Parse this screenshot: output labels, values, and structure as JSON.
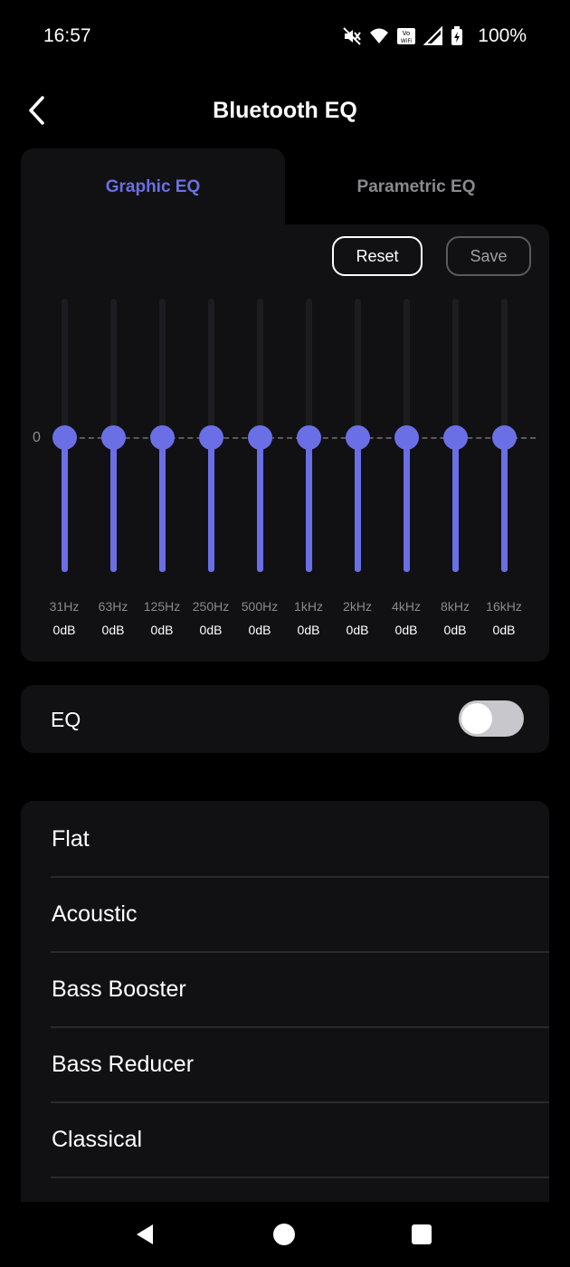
{
  "status_bar": {
    "time": "16:57",
    "battery": "100%",
    "icons": [
      "mute-icon",
      "wifi-icon",
      "vowifi-icon",
      "signal-icon",
      "battery-icon"
    ]
  },
  "header": {
    "title": "Bluetooth EQ",
    "back_icon": "chevron-left-icon"
  },
  "tabs": [
    {
      "label": "Graphic EQ",
      "active": true
    },
    {
      "label": "Parametric EQ",
      "active": false
    }
  ],
  "eq": {
    "reset_label": "Reset",
    "save_label": "Save",
    "zero_label": "0",
    "accent_color": "#6b6fe6",
    "bands": [
      {
        "freq": "31Hz",
        "gain": "0dB",
        "level": 0
      },
      {
        "freq": "63Hz",
        "gain": "0dB",
        "level": 0
      },
      {
        "freq": "125Hz",
        "gain": "0dB",
        "level": 0
      },
      {
        "freq": "250Hz",
        "gain": "0dB",
        "level": 0
      },
      {
        "freq": "500Hz",
        "gain": "0dB",
        "level": 0
      },
      {
        "freq": "1kHz",
        "gain": "0dB",
        "level": 0
      },
      {
        "freq": "2kHz",
        "gain": "0dB",
        "level": 0
      },
      {
        "freq": "4kHz",
        "gain": "0dB",
        "level": 0
      },
      {
        "freq": "8kHz",
        "gain": "0dB",
        "level": 0
      },
      {
        "freq": "16kHz",
        "gain": "0dB",
        "level": 0
      }
    ]
  },
  "eq_toggle": {
    "label": "EQ",
    "enabled": false
  },
  "presets": [
    "Flat",
    "Acoustic",
    "Bass Booster",
    "Bass Reducer",
    "Classical"
  ],
  "nav_bar": {
    "icons": [
      "back-triangle-icon",
      "home-circle-icon",
      "recents-square-icon"
    ]
  }
}
